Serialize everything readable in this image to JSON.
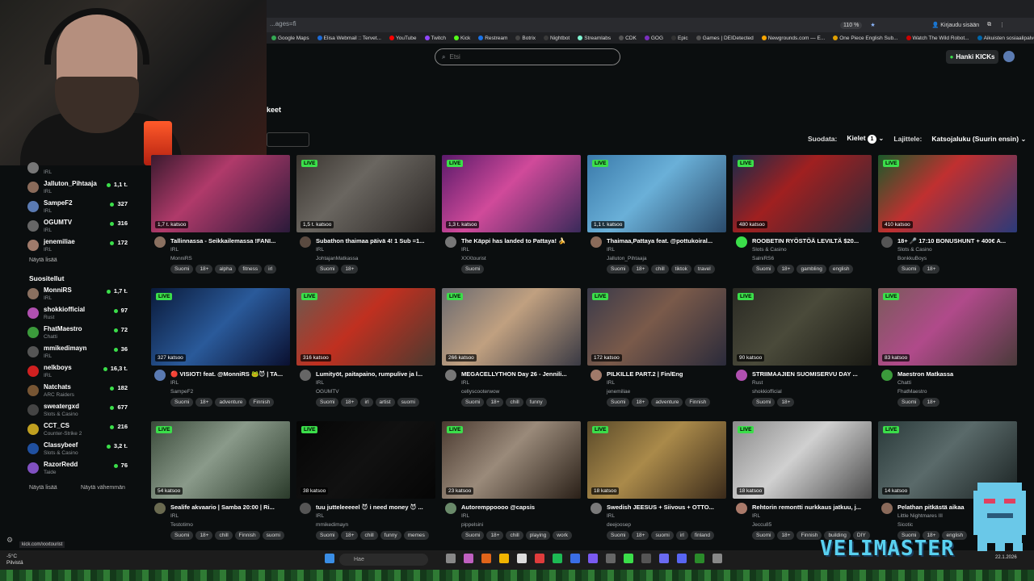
{
  "browser": {
    "address": "...ages=fi",
    "zoom": "110 %",
    "signin": "Kirjaudu sisään",
    "bookmarks": [
      {
        "label": "Google Maps",
        "color": "#34a853"
      },
      {
        "label": "Elisa Webmail :: Tervet...",
        "color": "#1c6bd6"
      },
      {
        "label": "YouTube",
        "color": "#ff0000"
      },
      {
        "label": "Twitch",
        "color": "#9146ff"
      },
      {
        "label": "Kick",
        "color": "#53fc18"
      },
      {
        "label": "Restream",
        "color": "#1a73e8"
      },
      {
        "label": "Botrix",
        "color": "#444444"
      },
      {
        "label": "Nightbot",
        "color": "#3a3a3a"
      },
      {
        "label": "Streamlabs",
        "color": "#80f5d2"
      },
      {
        "label": "CDK",
        "color": "#555555"
      },
      {
        "label": "GOG",
        "color": "#7b2fbf"
      },
      {
        "label": "Epic",
        "color": "#333333"
      },
      {
        "label": "Games | DEIDetected",
        "color": "#555555"
      },
      {
        "label": "Newgrounds.com — E...",
        "color": "#f7a501"
      },
      {
        "label": "One Piece English Sub...",
        "color": "#e0a000"
      },
      {
        "label": "Watch The Wild Robot...",
        "color": "#cc0000"
      },
      {
        "label": "Aikuisten sosiaalipalve...",
        "color": "#0066aa"
      },
      {
        "label": "Muut kirjanmerkit",
        "color": "#777777"
      }
    ]
  },
  "header": {
    "search_placeholder": "Etsi",
    "hanki_label": "Hanki KICKs",
    "section_title": "keet"
  },
  "filters": {
    "suodata_label": "Suodata:",
    "kielet_label": "Kielet",
    "kielet_count": "1",
    "lajittele_label": "Lajittele:",
    "sort_value": "Katsojaluku (Suurin ensin)"
  },
  "sidebar": {
    "top_items": [
      {
        "name": "",
        "category": "IRL",
        "viewers": "",
        "color": "#777"
      },
      {
        "name": "Jalluton_Pihtaaja",
        "category": "IRL",
        "viewers": "1,1 t.",
        "color": "#8a6b5a"
      },
      {
        "name": "SampeF2",
        "category": "IRL",
        "viewers": "327",
        "color": "#5a7ab2"
      },
      {
        "name": "OGUMTV",
        "category": "IRL",
        "viewers": "316",
        "color": "#666"
      },
      {
        "name": "jenemiliae",
        "category": "IRL",
        "viewers": "172",
        "color": "#a07a6a"
      }
    ],
    "show_more": "Näytä lisää",
    "recommended_title": "Suositellut",
    "recommended": [
      {
        "name": "MonniRS",
        "category": "IRL",
        "viewers": "1,7 t.",
        "color": "#8a7060"
      },
      {
        "name": "shokkiofficial",
        "category": "Rust",
        "viewers": "97",
        "color": "#b050b0"
      },
      {
        "name": "FhatMaestro",
        "category": "Chatti",
        "viewers": "72",
        "color": "#3b9a3b"
      },
      {
        "name": "mmikedimayn",
        "category": "IRL",
        "viewers": "36",
        "color": "#555"
      },
      {
        "name": "nelkboys",
        "category": "IRL",
        "viewers": "16,3 t.",
        "color": "#d02020"
      },
      {
        "name": "Natchats",
        "category": "ARC Raiders",
        "viewers": "182",
        "color": "#775533"
      },
      {
        "name": "sweatergxd",
        "category": "Slots & Casino",
        "viewers": "677",
        "color": "#444"
      },
      {
        "name": "CCT_CS",
        "category": "Counter-Strike 2",
        "viewers": "216",
        "color": "#c0a020"
      },
      {
        "name": "Classybeef",
        "category": "Slots & Casino",
        "viewers": "3,2 t.",
        "color": "#2050a0"
      },
      {
        "name": "RazorRedd",
        "category": "Taide",
        "viewers": "76",
        "color": "#8050c0"
      }
    ],
    "show_more_2": "Näytä lisää",
    "show_less": "Näytä vähemmän"
  },
  "streams": [
    {
      "viewers": "1,7 t. katsoo",
      "title": "Tallinnassa - Seikkailemassa !FANI...",
      "category": "IRL",
      "user": "MonniRS",
      "tags": [
        "Suomi",
        "18+",
        "alpha",
        "fitness",
        "irl"
      ],
      "thumb": "linear-gradient(135deg,#3a1a2e,#b03a6a 40%,#2a1a3a)",
      "av": "#8a7060",
      "live": false
    },
    {
      "viewers": "1,5 t. katsoo",
      "title": "Subathon thaimaa päivä 4! 1 Sub =1...",
      "category": "IRL",
      "user": "JohtajanMatkassa",
      "tags": [
        "Suomi",
        "18+"
      ],
      "thumb": "linear-gradient(135deg,#3a3530,#6a6660 40%,#2a2624)",
      "av": "#5a4a40",
      "live": true
    },
    {
      "viewers": "1,3 t. katsoo",
      "title": "The Käppi has landed to Pattaya! 🍌",
      "category": "IRL",
      "user": "XXXtourist",
      "tags": [
        "Suomi"
      ],
      "thumb": "linear-gradient(135deg,#5a1a6a,#d04a9a 45%,#3a2a5a)",
      "av": "#777",
      "live": true
    },
    {
      "viewers": "1,1 t. katsoo",
      "title": "Thaimaa,Pattaya feat. @pottukoiral...",
      "category": "IRL",
      "user": "Jalluton_Pihtaaja",
      "tags": [
        "Suomi",
        "18+",
        "chill",
        "tiktok",
        "travel"
      ],
      "thumb": "linear-gradient(135deg,#3a7aaa,#6ab0d8 45%,#2a4a6a)",
      "av": "#8a6b5a",
      "live": true
    },
    {
      "viewers": "480 katsoo",
      "title": "ROOBETIN RYÖSTÖÄ LEVILTÄ $20...",
      "category": "Slots & Casino",
      "user": "SalniRS6",
      "tags": [
        "Suomi",
        "18+",
        "gambling",
        "english"
      ],
      "thumb": "linear-gradient(135deg,#1a2a4a,#a02020 40%,#2a2a3a)",
      "av": "#3bde4a",
      "live": true
    },
    {
      "viewers": "410 katsoo",
      "title": "18+ 🎤 17:10 BONUSHUNT + 400€ A...",
      "category": "Slots & Casino",
      "user": "BonkkuBoys",
      "tags": [
        "Suomi",
        "18+"
      ],
      "thumb": "linear-gradient(135deg,#1a5a2a,#c03030 40%,#2a3a7a)",
      "av": "#555",
      "live": true
    },
    {
      "viewers": "327 katsoo",
      "title": "🔴 VISIOT! feat. @MonniRS 🐸😈 | TA...",
      "category": "IRL",
      "user": "SampeF2",
      "tags": [
        "Suomi",
        "18+",
        "adventure",
        "Finnish"
      ],
      "thumb": "linear-gradient(135deg,#0a1a3a,#2a5a9a 50%,#0a1030)",
      "av": "#5a7ab2",
      "live": true
    },
    {
      "viewers": "316 katsoo",
      "title": "Lumityöt, paitapaino, rumpulive ja l...",
      "category": "IRL",
      "user": "OGUMTV",
      "tags": [
        "Suomi",
        "18+",
        "irl",
        "artist",
        "suomi"
      ],
      "thumb": "linear-gradient(135deg,#6a5a50,#c03020 45%,#4a3a30)",
      "av": "#666",
      "live": true
    },
    {
      "viewers": "266 katsoo",
      "title": "MEGACELLYTHON Day 26 - Jennili...",
      "category": "IRL",
      "user": "cellyscooterwow",
      "tags": [
        "Suomi",
        "18+",
        "chill",
        "funny"
      ],
      "thumb": "linear-gradient(135deg,#6a6a70,#c0a080 45%,#3a3a44)",
      "av": "#777",
      "live": true
    },
    {
      "viewers": "172 katsoo",
      "title": "PILKILLE PART.2 | Fin/Eng",
      "category": "IRL",
      "user": "jenemiliae",
      "tags": [
        "Suomi",
        "18+",
        "adventure",
        "Finnish"
      ],
      "thumb": "linear-gradient(135deg,#3a3a4a,#7a5a4a 45%,#2a2a3a)",
      "av": "#a07a6a",
      "live": true
    },
    {
      "viewers": "90 katsoo",
      "title": "STRIIMAAJIEN SUOMISERVU DAY ...",
      "category": "Rust",
      "user": "shokkiofficial",
      "tags": [
        "Suomi",
        "18+"
      ],
      "thumb": "linear-gradient(135deg,#2a2a24,#4a4a3a 45%,#1a1a14)",
      "av": "#b050b0",
      "live": true
    },
    {
      "viewers": "83 katsoo",
      "title": "Maestron Matkassa",
      "category": "Chatti",
      "user": "FhatMaestro",
      "tags": [
        "Suomi",
        "18+"
      ],
      "thumb": "linear-gradient(135deg,#7a5a5a,#b04a8a 45%,#4a3a3a)",
      "av": "#3b9a3b",
      "live": true
    },
    {
      "viewers": "54 katsoo",
      "title": "Sealife akvaario | Samba 20:00 | Ri...",
      "category": "IRL",
      "user": "Testotimo",
      "tags": [
        "Suomi",
        "18+",
        "chill",
        "Finnish",
        "suomi"
      ],
      "thumb": "linear-gradient(135deg,#3a4a3a,#8a9a8a 45%,#2a3a2a)",
      "av": "#6a6a50",
      "live": true
    },
    {
      "viewers": "38 katsoo",
      "title": "tuu jutteleeeeel 😈 i need money 😈 ...",
      "category": "IRL",
      "user": "mmikedimayn",
      "tags": [
        "Suomi",
        "18+",
        "chill",
        "funny",
        "memes"
      ],
      "thumb": "linear-gradient(135deg,#050505,#111 50%,#050505)",
      "av": "#555",
      "live": true
    },
    {
      "viewers": "23 katsoo",
      "title": "Autoremppoooo @capsis",
      "category": "IRL",
      "user": "pippelsini",
      "tags": [
        "Suomi",
        "18+",
        "chill",
        "playing",
        "work"
      ],
      "thumb": "linear-gradient(135deg,#4a3a30,#9a8a7a 45%,#2a2018)",
      "av": "#6a8a6a",
      "live": true
    },
    {
      "viewers": "18 katsoo",
      "title": "Swedish JEESUS + Siivous + OTTO...",
      "category": "IRL",
      "user": "deejoosep",
      "tags": [
        "Suomi",
        "18+",
        "suomi",
        "irl",
        "finland"
      ],
      "thumb": "linear-gradient(135deg,#5a4a2a,#aa8a4a 45%,#3a2a1a)",
      "av": "#7a7a7a",
      "live": true
    },
    {
      "viewers": "18 katsoo",
      "title": "Rehtorin remontti nurkkaus jatkuu, j...",
      "category": "IRL",
      "user": "Jeccu85",
      "tags": [
        "Suomi",
        "18+",
        "Finnish",
        "building",
        "DIY"
      ],
      "thumb": "linear-gradient(135deg,#8a8a8a,#d0d0d0 45%,#4a4a4a)",
      "av": "#aa7a6a",
      "live": true
    },
    {
      "viewers": "14 katsoo",
      "title": "Pelathan pitkästä aikaa",
      "category": "Little Nightmares III",
      "user": "Sicotic",
      "tags": [
        "Suomi",
        "18+",
        "english"
      ],
      "thumb": "linear-gradient(135deg,#2a3a3a,#5a6a6a 45%,#1a2222)",
      "av": "#8a6a5a",
      "live": true
    }
  ],
  "live_label": "LIVE",
  "taskbar": {
    "temp": "-5°C",
    "weather": "Pilvistä",
    "search": "Hae",
    "date": "22.1.2026"
  },
  "status_url": "kick.com/xxxtourist",
  "overlay_brand": "VELIMASTER"
}
